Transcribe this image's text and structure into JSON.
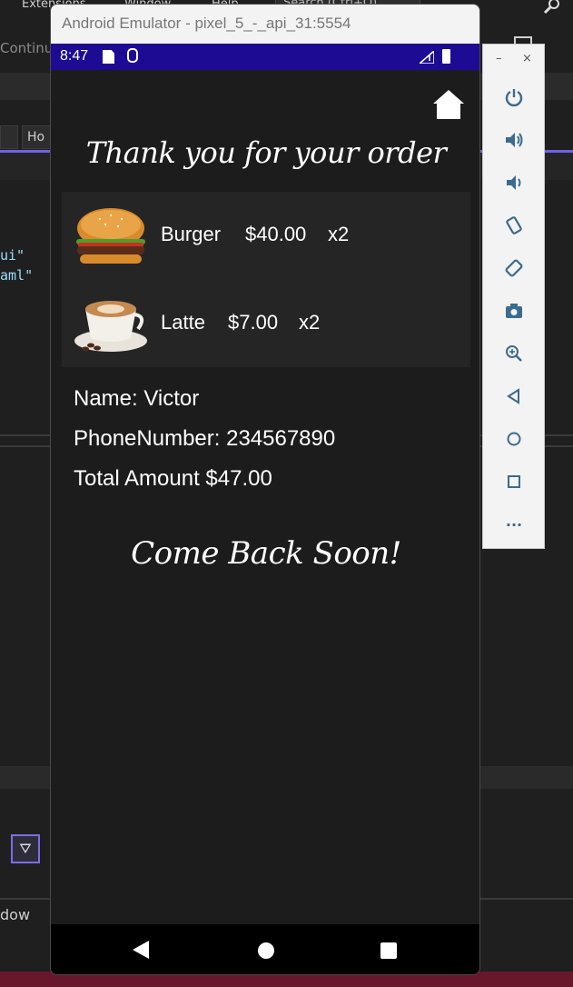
{
  "ide": {
    "menu_items": [
      "Extensions",
      "Window",
      "Help"
    ],
    "search_label": "Search (Ctrl+Q)",
    "continue_label": "Continu",
    "tab_label": "Ho",
    "code_lines": [
      "ui\"",
      "aml\""
    ],
    "window_label": "dow"
  },
  "emulator": {
    "title": "Android Emulator - pixel_5_-_api_31:5554",
    "status_time": "8:47",
    "side_minimize": "–",
    "side_close": "×",
    "side_more": "···"
  },
  "app": {
    "heading": "Thank you for your order",
    "items": [
      {
        "name": "Burger",
        "price": "$40.00",
        "qty": "x2",
        "image": "burger-image"
      },
      {
        "name": "Latte",
        "price": "$7.00",
        "qty": "x2",
        "image": "latte-image"
      }
    ],
    "customer": {
      "name_line": "Name: Victor",
      "phone_line": "PhoneNumber: 234567890",
      "total_line": "Total Amount $47.00"
    },
    "footer": "Come Back Soon!"
  },
  "colors": {
    "status_bar": "#1d0b94",
    "app_bg": "#1c1c1c",
    "list_bg": "#252525",
    "ide_accent": "#7160e8",
    "ide_status": "#68172b"
  }
}
